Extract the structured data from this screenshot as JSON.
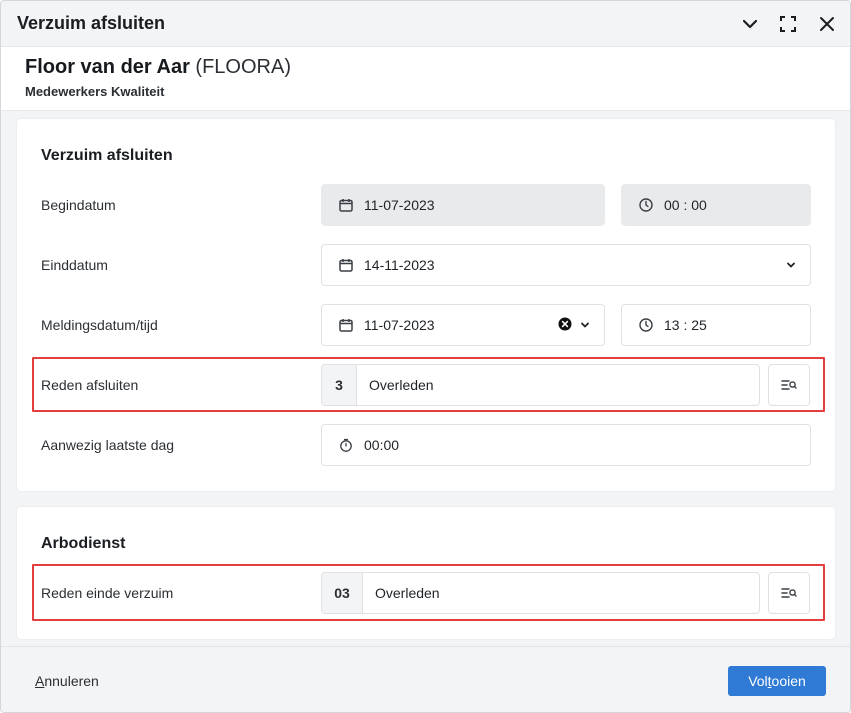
{
  "window": {
    "title": "Verzuim afsluiten",
    "icons": {
      "collapse": "chevron-down-icon",
      "maximize": "maximize-icon",
      "close": "close-icon"
    }
  },
  "employee": {
    "name": "Floor van der Aar",
    "code": "(FLOORA)",
    "department": "Medewerkers Kwaliteit"
  },
  "section_close": {
    "title": "Verzuim afsluiten",
    "begindatum": {
      "label": "Begindatum",
      "date": "11-07-2023",
      "time": "00 : 00"
    },
    "einddatum": {
      "label": "Einddatum",
      "date": "14-11-2023"
    },
    "meldingsdatum": {
      "label": "Meldingsdatum/tijd",
      "date": "11-07-2023",
      "time": "13 : 25"
    },
    "reden_afsluiten": {
      "label": "Reden afsluiten",
      "code": "3",
      "value": "Overleden"
    },
    "aanwezig": {
      "label": "Aanwezig laatste dag",
      "value": "00:00"
    }
  },
  "section_arbo": {
    "title": "Arbodienst",
    "reden_einde": {
      "label": "Reden einde verzuim",
      "code": "03",
      "value": "Overleden"
    }
  },
  "footer": {
    "cancel_first": "A",
    "cancel_rest": "nnuleren",
    "finish_pre": "Vol",
    "finish_u": "t",
    "finish_post": "ooien"
  },
  "colors": {
    "primary": "#2f7ad4",
    "highlight": "#e53e3e"
  }
}
